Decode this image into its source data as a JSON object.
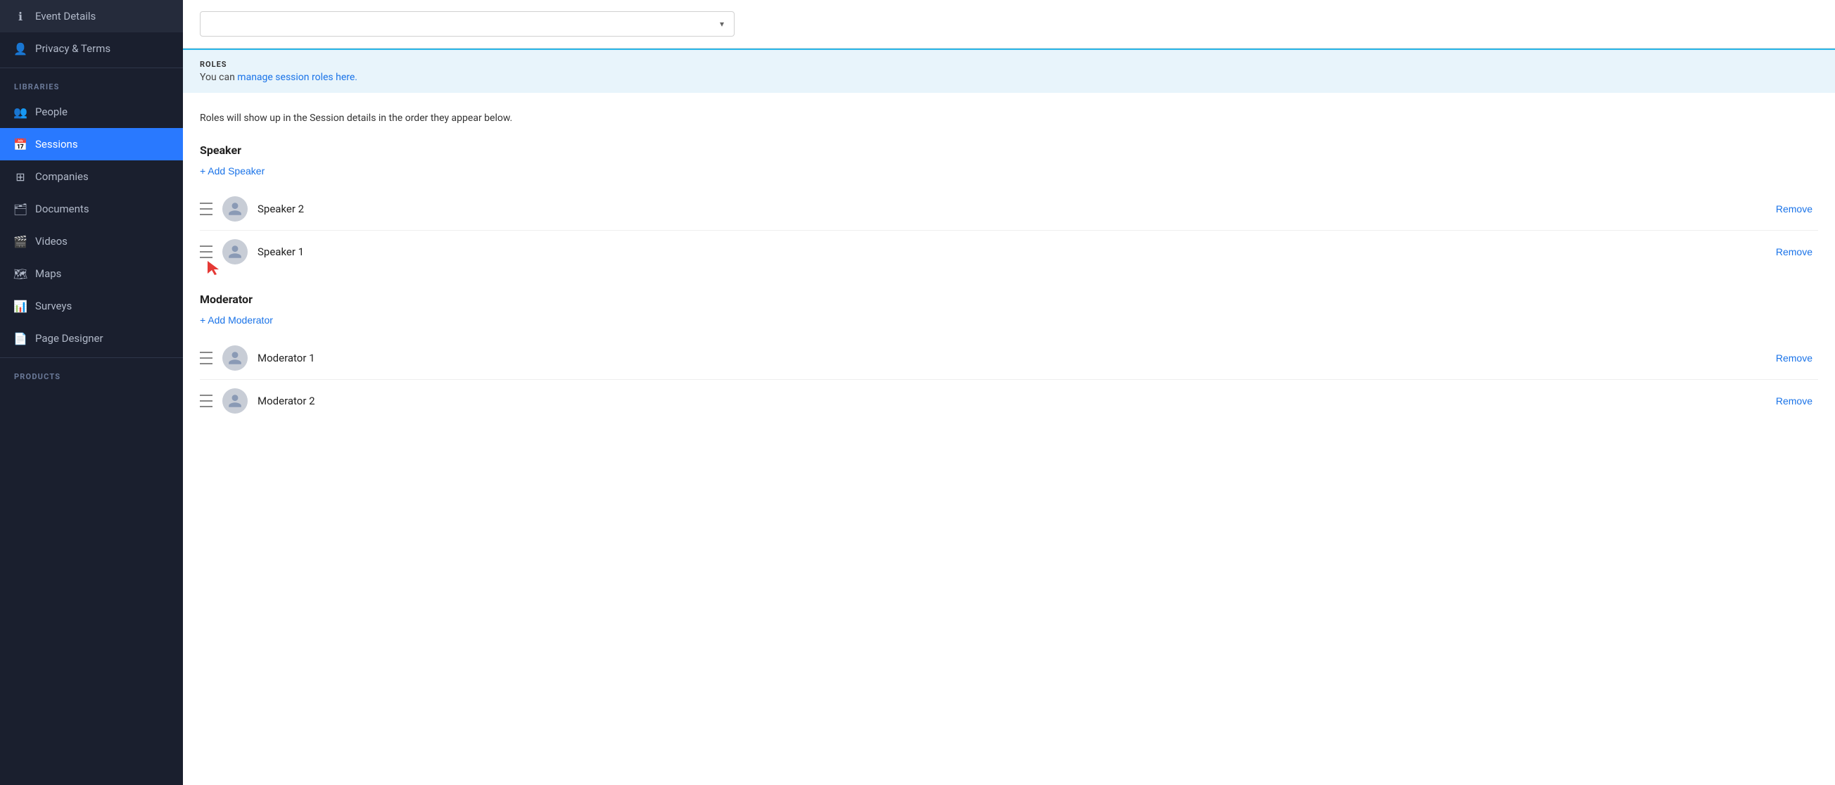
{
  "sidebar": {
    "items": [
      {
        "id": "event-details",
        "label": "Event Details",
        "icon": "ℹ",
        "active": false
      },
      {
        "id": "privacy-terms",
        "label": "Privacy & Terms",
        "icon": "👤",
        "active": false
      }
    ],
    "libraries_label": "LIBRARIES",
    "library_items": [
      {
        "id": "people",
        "label": "People",
        "icon": "👥",
        "active": false
      },
      {
        "id": "sessions",
        "label": "Sessions",
        "icon": "📅",
        "active": true
      },
      {
        "id": "companies",
        "label": "Companies",
        "icon": "⊞",
        "active": false
      },
      {
        "id": "documents",
        "label": "Documents",
        "icon": "🗂",
        "active": false
      },
      {
        "id": "videos",
        "label": "Videos",
        "icon": "🎬",
        "active": false
      },
      {
        "id": "maps",
        "label": "Maps",
        "icon": "🗺",
        "active": false
      },
      {
        "id": "surveys",
        "label": "Surveys",
        "icon": "📊",
        "active": false
      },
      {
        "id": "page-designer",
        "label": "Page Designer",
        "icon": "📄",
        "active": false
      }
    ],
    "products_label": "PRODUCTS"
  },
  "top_dropdown": {
    "placeholder": "",
    "chevron": "▾"
  },
  "roles_banner": {
    "section_label": "ROLES",
    "description_prefix": "You can ",
    "link_text": "manage session roles here.",
    "description_suffix": ""
  },
  "content": {
    "description": "Roles will show up in the Session details in the order they appear below.",
    "speaker_section": {
      "title": "Speaker",
      "add_label": "+ Add Speaker",
      "people": [
        {
          "id": "speaker-2",
          "name": "Speaker 2"
        },
        {
          "id": "speaker-1",
          "name": "Speaker 1"
        }
      ],
      "remove_label": "Remove"
    },
    "moderator_section": {
      "title": "Moderator",
      "add_label": "+ Add Moderator",
      "people": [
        {
          "id": "moderator-1",
          "name": "Moderator 1"
        },
        {
          "id": "moderator-2",
          "name": "Moderator 2"
        }
      ],
      "remove_label": "Remove"
    }
  }
}
